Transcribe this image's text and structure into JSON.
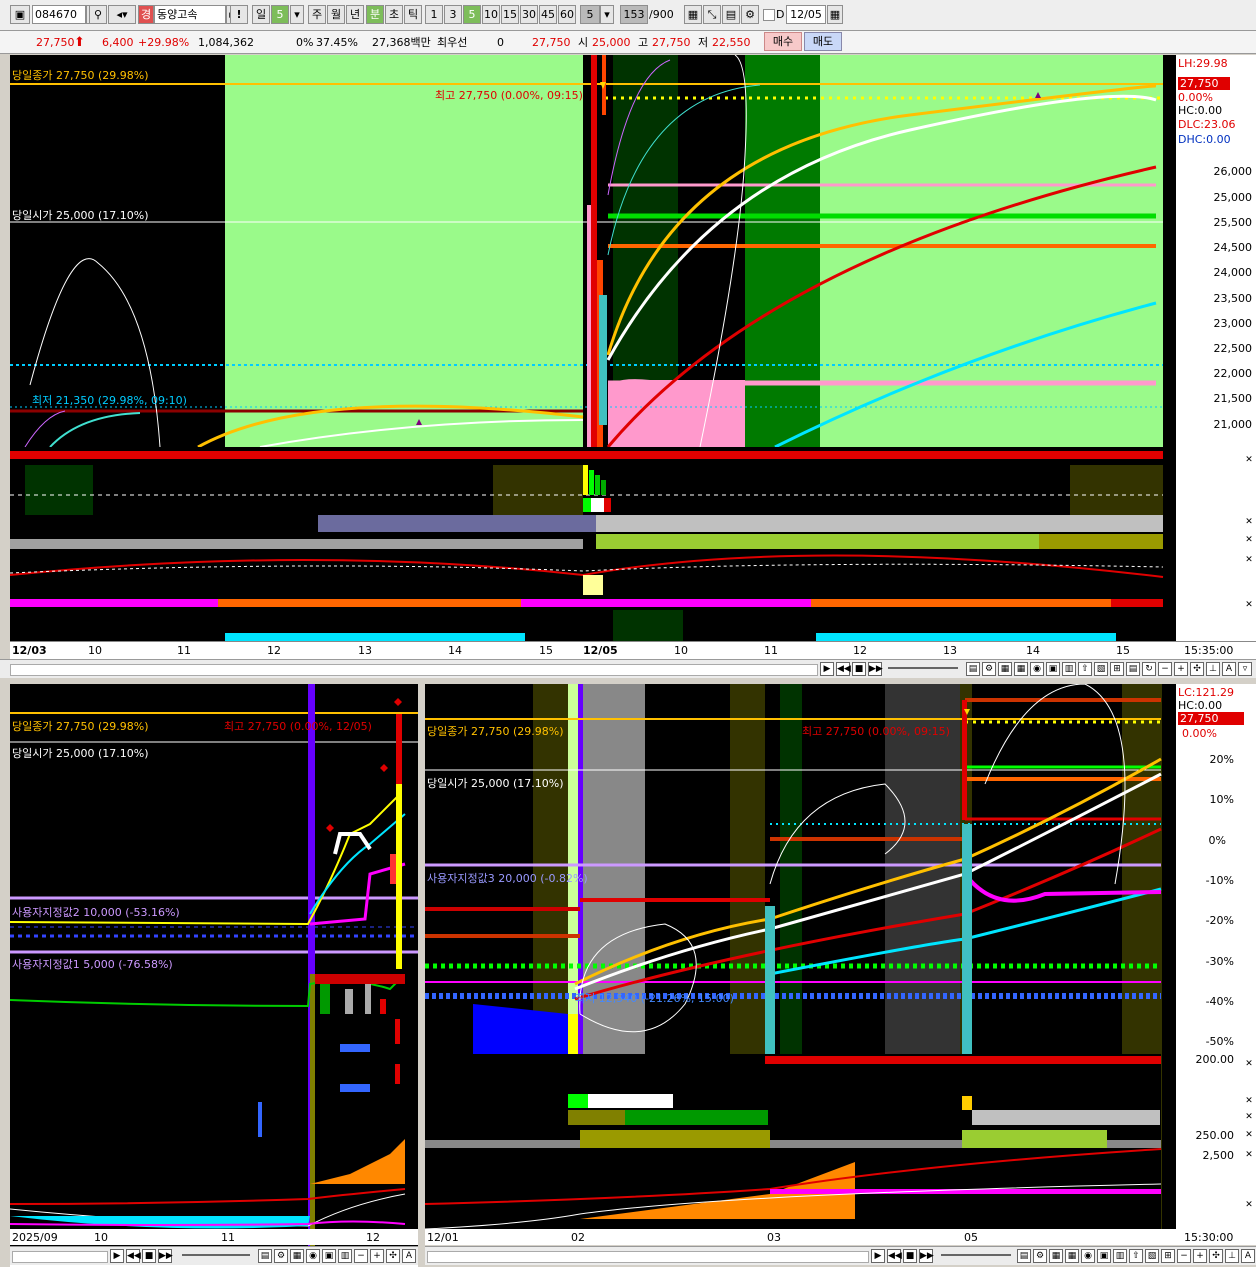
{
  "toolbar": {
    "code": "084670",
    "exchange_badge": "경",
    "stock_name": "동양고속",
    "alert_icon": "!",
    "period_day": "일",
    "period_day_n": "5",
    "period_week": "주",
    "period_month": "월",
    "period_year": "년",
    "period_minute": "분",
    "period_second": "초",
    "period_tick": "틱",
    "intervals": [
      "1",
      "3",
      "5",
      "10",
      "15",
      "30",
      "45",
      "60"
    ],
    "interval_selected": "5",
    "count": "153",
    "count_max": "/900",
    "date_check_label": "D",
    "date_value": "12/05"
  },
  "quote": {
    "price": "27,750",
    "change": "6,400",
    "change_pct": "+29.98%",
    "volume": "1,084,362",
    "vol_ratio_a": "0%",
    "vol_ratio_b": "37.45%",
    "amount": "27,368백만",
    "best_bid_label": "최우선",
    "best_bid_value": "0",
    "best_ask": "27,750",
    "open_label": "시",
    "open": "25,000",
    "high_label": "고",
    "high": "27,750",
    "low_label": "저",
    "low": "22,550",
    "buy_label": "매수",
    "sell_label": "매도"
  },
  "top_chart": {
    "close_line": "당일종가 27,750 (29.98%)",
    "high_note": "최고 27,750 (0.00%, 09:15)",
    "open_line": "당일시가 25,000 (17.10%)",
    "low_note": "최저 21,350 (29.98%, 09:10)",
    "price_axis": [
      "26,000",
      "25,500",
      "25,000",
      "24,500",
      "24,000",
      "23,500",
      "23,000",
      "22,500",
      "22,000",
      "21,500",
      "21,000"
    ],
    "axis_info": {
      "lh": "LH:29.98",
      "price": "27,750",
      "pct": "0.00%",
      "hc": "HC:0.00",
      "dlc": "DLC:23.06",
      "dhc": "DHC:0.00"
    },
    "time_axis": [
      "12/03",
      "10",
      "11",
      "12",
      "13",
      "14",
      "15",
      "12/05",
      "10",
      "11",
      "12",
      "13",
      "14",
      "15"
    ],
    "time_corner": "15:35:00"
  },
  "bottom_left": {
    "close_line": "당일종가 27,750 (29.98%)",
    "high_note": "최고 27,750 (0.00%, 12/05)",
    "open_line": "당일시가 25,000 (17.10%)",
    "user2": "사용자지정값2 10,000 (-53.16%)",
    "user1": "사용자지정값1 5,000 (-76.58%)",
    "time_axis": [
      "2025/09",
      "10",
      "11",
      "12"
    ]
  },
  "bottom_right": {
    "close_line": "당일종가 27,750 (29.98%)",
    "high_note": "최고 27,750 (0.00%, 09:15)",
    "open_line": "당일시가 25,000 (17.10%)",
    "user_line": "사용자지정값3 20,000 (-0.82%)",
    "low_note": "최저 12,540 (-21.26%, 15:00)",
    "pct_axis": [
      "20%",
      "10%",
      "0%",
      "-10%",
      "-20%",
      "-30%",
      "-40%",
      "-50%"
    ],
    "axis_info": {
      "lc": "LC:121.29",
      "price": "27,750",
      "pct": "0.00%",
      "hc": "HC:0.00"
    },
    "sub_axis": [
      "200.00",
      "250.00",
      "2,500"
    ],
    "time_axis": [
      "12/01",
      "02",
      "03",
      "05"
    ],
    "time_corner": "15:30:00"
  }
}
